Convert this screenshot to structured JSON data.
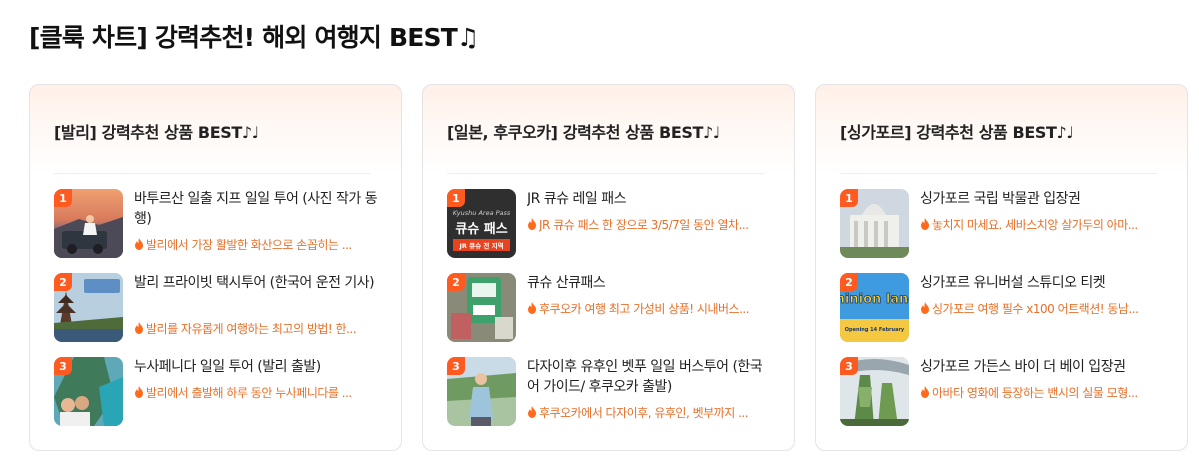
{
  "page": {
    "title": "[클룩 차트] 강력추천! 해외 여행지 BEST♫"
  },
  "colors": {
    "accent": "#ff5a1f",
    "desc_text": "#e8702a"
  },
  "cards": [
    {
      "title": "[발리] 강력추천 상품 BEST♪♩",
      "items": [
        {
          "rank": "1",
          "title": "바투르산 일출 지프 일일 투어 (사진 작가 동행)",
          "desc": "발리에서 가장 활발한 화산으로 손꼽히는 ...",
          "icon": "flame-icon"
        },
        {
          "rank": "2",
          "title": "발리 프라이빗 택시투어 (한국어 운전 기사)",
          "desc": "발리를 자유롭게 여행하는 최고의 방법! 한...",
          "icon": "flame-icon"
        },
        {
          "rank": "3",
          "title": "누사페니다 일일 투어 (발리 출발)",
          "desc": "발리에서 출발해 하루 동안 누사페니다를 ...",
          "icon": "flame-icon"
        }
      ]
    },
    {
      "title": "[일본, 후쿠오카] 강력추천 상품 BEST♪♩",
      "items": [
        {
          "rank": "1",
          "title": "JR 큐슈 레일 패스",
          "desc": "JR 큐슈 패스 한 장으로 3/5/7일 동안 열차...",
          "icon": "flame-icon",
          "thumb_text": "큐슈 패스",
          "thumb_subtext": "JR 큐슈 전 지역",
          "thumb_small": "Kyushu Area Pass"
        },
        {
          "rank": "2",
          "title": "큐슈 산큐패스",
          "desc": "후쿠오카 여행 최고 가성비 상품! 시내버스...",
          "icon": "flame-icon"
        },
        {
          "rank": "3",
          "title": "다자이후 유후인 벳푸 일일 버스투어 (한국어 가이드/ 후쿠오카 출발)",
          "desc": "후쿠오카에서 다자이후, 유후인, 벳부까지 ...",
          "icon": "flame-icon"
        }
      ]
    },
    {
      "title": "[싱가포르] 강력추천 상품 BEST♪♩",
      "items": [
        {
          "rank": "1",
          "title": "싱가포르 국립 박물관 입장권",
          "desc": "놓치지 마세요. 세바스치앙 살가두의 아마...",
          "icon": "flame-icon"
        },
        {
          "rank": "2",
          "title": "싱가포르 유니버설 스튜디오 티켓",
          "desc": "싱가포르 여행 필수 x100 어트랙션! 동남...",
          "icon": "flame-icon",
          "thumb_text": "minion land",
          "thumb_small": "Opening 14 February"
        },
        {
          "rank": "3",
          "title": "싱가포르 가든스 바이 더 베이 입장권",
          "desc": "아바타 영화에 등장하는 밴시의 실물 모형...",
          "icon": "flame-icon"
        }
      ]
    }
  ]
}
